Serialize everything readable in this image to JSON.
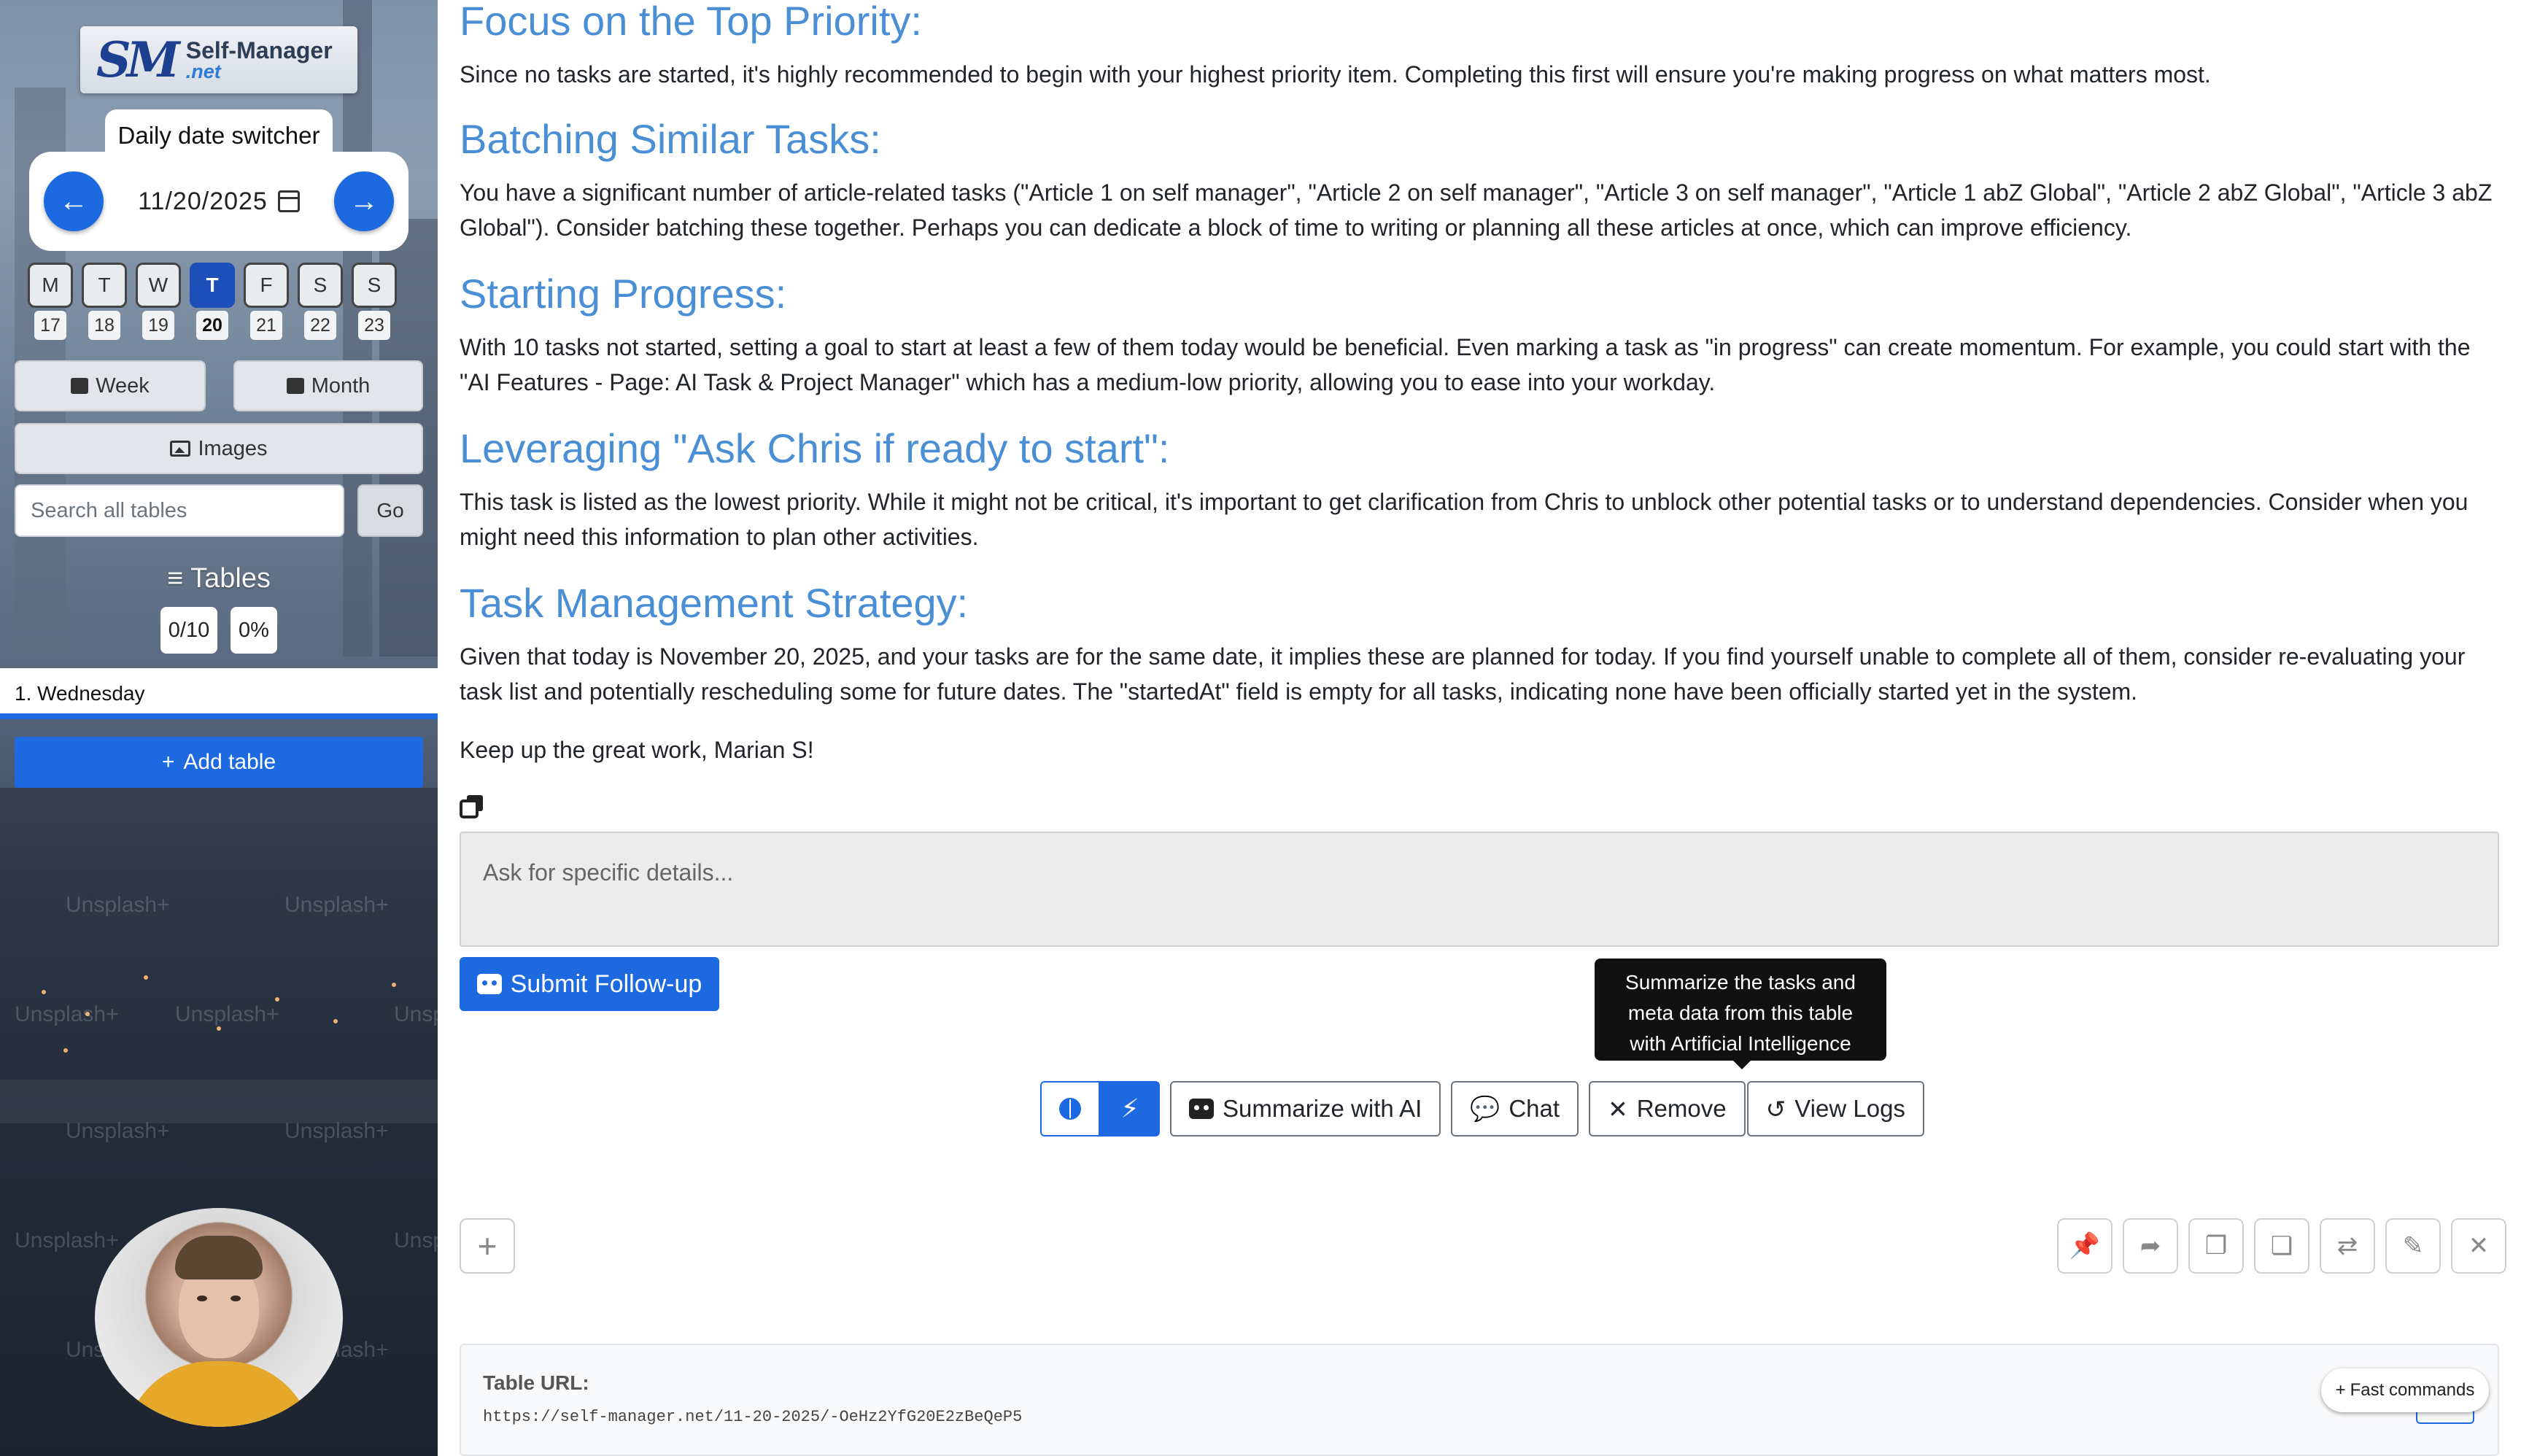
{
  "sidebar": {
    "logo": {
      "mark": "SM",
      "name": "Self-Manager",
      "tld": ".net"
    },
    "date_switcher_label": "Daily date switcher",
    "date": {
      "month": "11",
      "day": "20",
      "year": "2025"
    },
    "days": [
      {
        "letter": "M",
        "num": "17"
      },
      {
        "letter": "T",
        "num": "18"
      },
      {
        "letter": "W",
        "num": "19"
      },
      {
        "letter": "T",
        "num": "20",
        "active": true
      },
      {
        "letter": "F",
        "num": "21"
      },
      {
        "letter": "S",
        "num": "22"
      },
      {
        "letter": "S",
        "num": "23"
      }
    ],
    "week_label": "Week",
    "month_label": "Month",
    "images_label": "Images",
    "search_placeholder": "Search all tables",
    "go_label": "Go",
    "tables_heading": "Tables",
    "tables_count": "0/10",
    "tables_percent": "0%",
    "day_item": "1. Wednesday",
    "add_table_label": "Add table",
    "watermark": "Unsplash+"
  },
  "summary": {
    "sections": [
      {
        "heading": "Focus on the Top Priority:",
        "body": "Since no tasks are started, it's highly recommended to begin with your highest priority item. Completing this first will ensure you're making progress on what matters most."
      },
      {
        "heading": "Batching Similar Tasks:",
        "body": "You have a significant number of article-related tasks (\"Article 1 on self manager\", \"Article 2 on self manager\", \"Article 3 on self manager\", \"Article 1 abZ Global\", \"Article 2 abZ Global\", \"Article 3 abZ Global\"). Consider batching these together. Perhaps you can dedicate a block of time to writing or planning all these articles at once, which can improve efficiency."
      },
      {
        "heading": "Starting Progress:",
        "body": "With 10 tasks not started, setting a goal to start at least a few of them today would be beneficial. Even marking a task as \"in progress\" can create momentum. For example, you could start with the \"AI Features - Page: AI Task & Project Manager\" which has a medium-low priority, allowing you to ease into your workday."
      },
      {
        "heading": "Leveraging \"Ask Chris if ready to start\":",
        "body": "This task is listed as the lowest priority. While it might not be critical, it's important to get clarification from Chris to unblock other potential tasks or to understand dependencies. Consider when you might need this information to plan other activities."
      },
      {
        "heading": "Task Management Strategy:",
        "body": "Given that today is November 20, 2025, and your tasks are for the same date, it implies these are planned for today. If you find yourself unable to complete all of them, consider re-evaluating your task list and potentially rescheduling some for future dates. The \"startedAt\" field is empty for all tasks, indicating none have been officially started yet in the system."
      }
    ],
    "closing": "Keep up the great work, Marian S!"
  },
  "followup": {
    "placeholder": "Ask for specific details...",
    "submit_label": "Submit Follow-up"
  },
  "tooltip": {
    "line1": "Summarize the tasks and",
    "line2": "meta data from this table",
    "line3": "with Artificial Intelligence"
  },
  "toolbar": {
    "summarize_label": "Summarize with AI",
    "chat_label": "Chat",
    "remove_label": "Remove",
    "logs_label": "View Logs"
  },
  "table_url": {
    "label": "Table URL:",
    "value": "https://self-manager.net/11-20-2025/-OeHz2YfG20E2zBeQeP5"
  },
  "fast_commands_label": "Fast commands",
  "colors": {
    "accent": "#1d6ae0",
    "heading": "#4a8fd6",
    "tooltip_bg": "#111111"
  }
}
